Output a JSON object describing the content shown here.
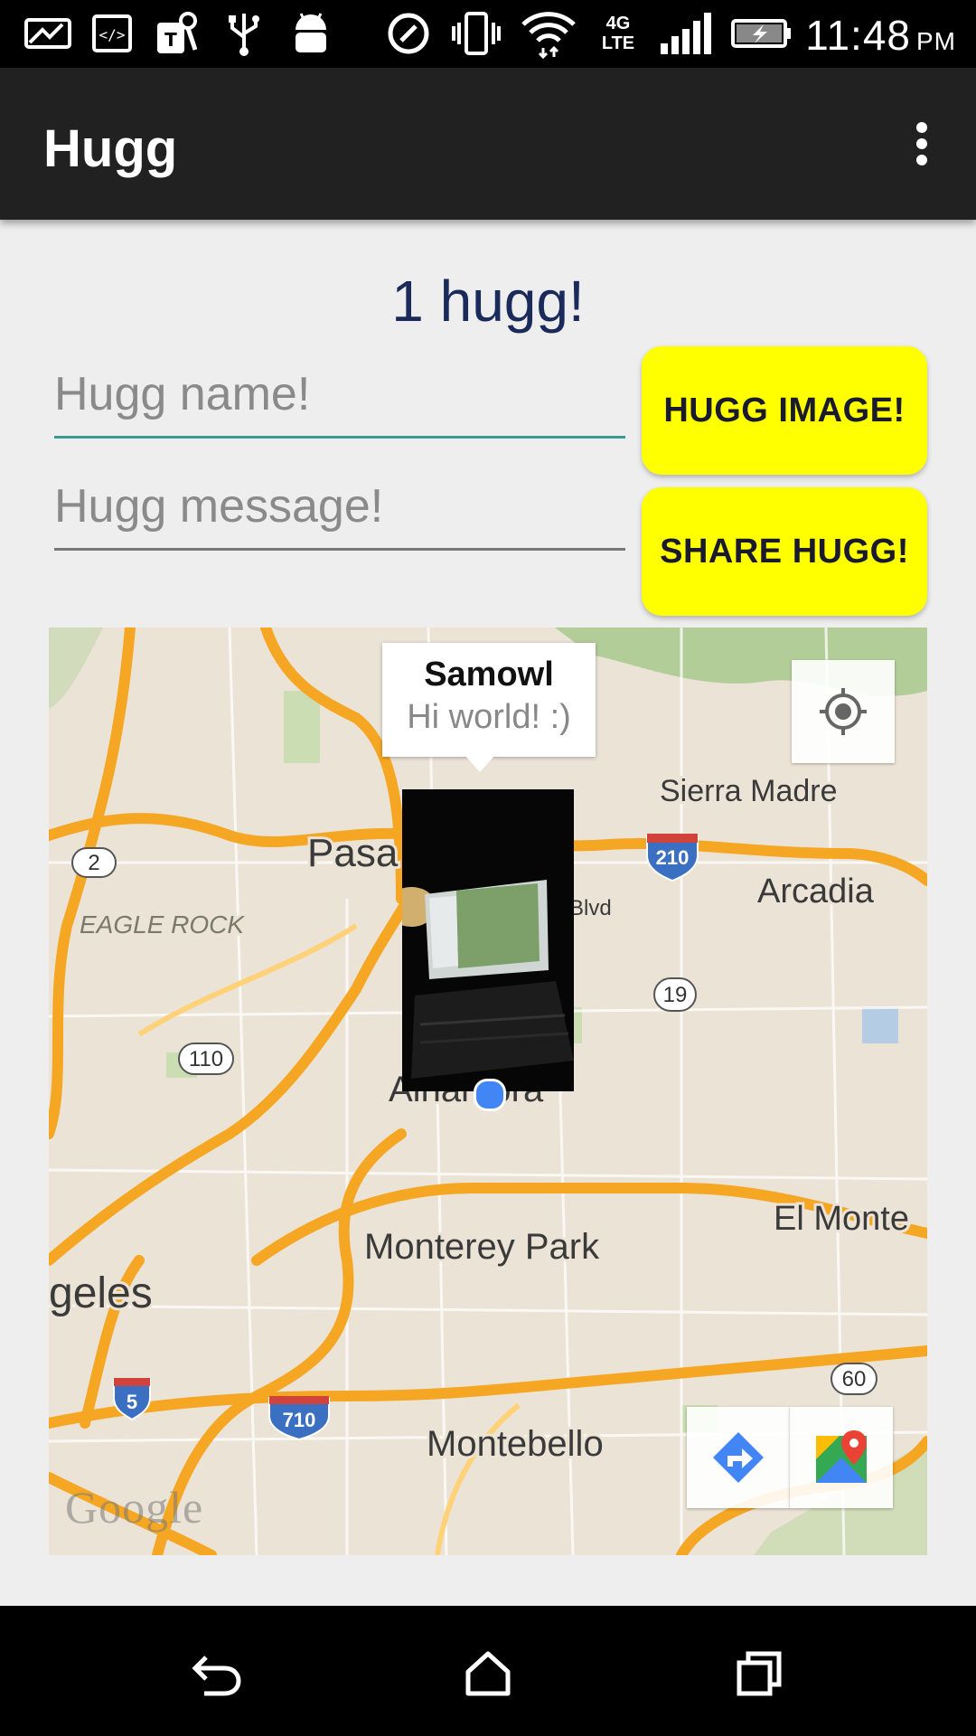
{
  "status_bar": {
    "time": "11:48",
    "ampm": "PM",
    "network": "4G LTE",
    "icons": [
      "picture-icon",
      "code-icon",
      "tmobile-icon",
      "usb-icon",
      "android-icon",
      "nfc-icon",
      "vibrate-icon",
      "wifi-icon",
      "network-4g-icon",
      "signal-icon",
      "battery-charging-icon"
    ]
  },
  "app_bar": {
    "title": "Hugg"
  },
  "main": {
    "hugg_count": "1 hugg!",
    "name_placeholder": "Hugg name!",
    "message_placeholder": "Hugg message!",
    "hugg_image_label": "HUGG IMAGE!",
    "share_hugg_label": "SHARE HUGG!"
  },
  "map": {
    "info_window": {
      "title": "Samowl",
      "message": "Hi world! :)"
    },
    "places": {
      "sierra_madre": "Sierra Madre",
      "pasadena": "Pasa",
      "arcadia": "Arcadia",
      "eagle_rock": "EAGLE ROCK",
      "alhambra": "Alhambra",
      "el_monte": "El Monte",
      "monterey_park": "Monterey Park",
      "los_angeles": "geles",
      "montebello": "Montebello",
      "blvd": "Blvd"
    },
    "shields": {
      "r2": "2",
      "i210": "210",
      "r19": "19",
      "r110": "110",
      "i5": "5",
      "i710": "710",
      "r60": "60"
    },
    "attribution": "Google"
  }
}
